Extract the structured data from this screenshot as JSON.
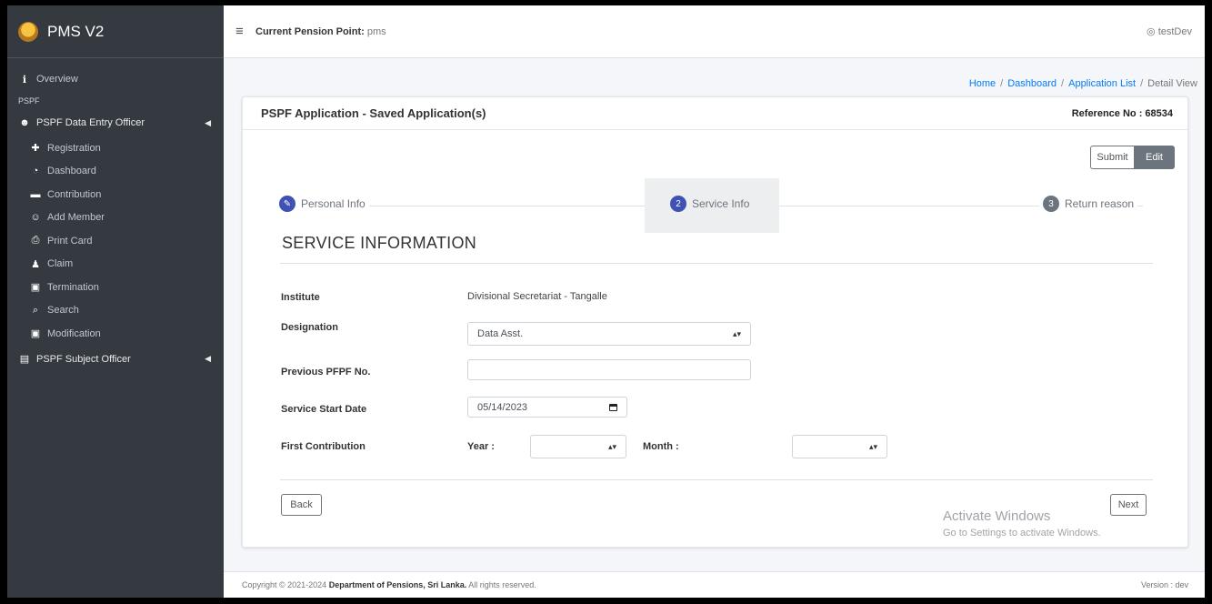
{
  "app": {
    "title": "PMS V2"
  },
  "sidebar": {
    "overview": "Overview",
    "section_header": "PSPF",
    "group1": "PSPF Data Entry Officer",
    "items": [
      "Registration",
      "Dashboard",
      "Contribution",
      "Add Member",
      "Print Card",
      "Claim",
      "Termination",
      "Search",
      "Modification"
    ],
    "group2": "PSPF Subject Officer"
  },
  "topbar": {
    "pension_point_label": "Current Pension Point:",
    "pension_point_value": "pms",
    "user": "testDev"
  },
  "breadcrumb": [
    "Home",
    "Dashboard",
    "Application List",
    "Detail View"
  ],
  "card": {
    "title": "PSPF Application - Saved Application(s)",
    "reference": "Reference No : 68534",
    "submit": "Submit",
    "edit": "Edit"
  },
  "steps": [
    {
      "num": "1",
      "label": "Personal Info"
    },
    {
      "num": "2",
      "label": "Service Info"
    },
    {
      "num": "3",
      "label": "Return reason"
    }
  ],
  "section_title": "SERVICE INFORMATION",
  "form": {
    "institute_label": "Institute",
    "institute_value": "Divisional Secretariat - Tangalle",
    "designation_label": "Designation",
    "designation_value": "Data Asst.",
    "prev_pfpf_label": "Previous PFPF No.",
    "prev_pfpf_value": "",
    "start_date_label": "Service Start Date",
    "start_date_value": "05/14/2023",
    "first_contrib_label": "First Contribution",
    "year_label": "Year :",
    "year_value": "",
    "month_label": "Month :",
    "month_value": ""
  },
  "nav_buttons": {
    "back": "Back",
    "next": "Next"
  },
  "watermark": {
    "line1": "Activate Windows",
    "line2": "Go to Settings to activate Windows."
  },
  "footer": {
    "copyright": "Copyright © 2021-2024",
    "org": "Department of Pensions, Sri Lanka.",
    "rights": "All rights reserved.",
    "version": "Version : dev"
  },
  "colors": {
    "sidebar": "#343a40",
    "accent": "#3f51b5",
    "link": "#007bff"
  }
}
